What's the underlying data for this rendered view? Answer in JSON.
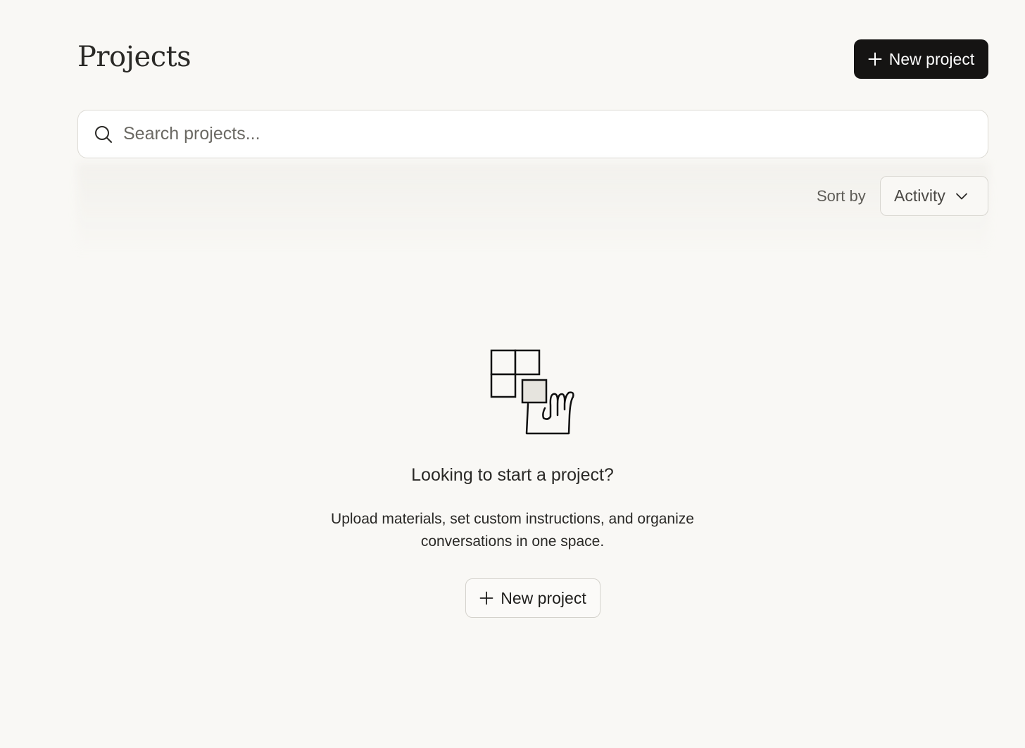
{
  "header": {
    "title": "Projects",
    "new_project_label": "New project"
  },
  "search": {
    "placeholder": "Search projects..."
  },
  "sort": {
    "label": "Sort by",
    "selected": "Activity"
  },
  "empty_state": {
    "title": "Looking to start a project?",
    "description": "Upload materials, set custom instructions, and organize conversations in one space.",
    "button_label": "New project"
  },
  "icons": {
    "primary_plus": "plus-icon",
    "search": "search-icon",
    "sort_chevron": "chevron-down-icon",
    "illustration": "grid-hand-illustration"
  },
  "colors": {
    "background": "#f9f8f5",
    "primary_button": "#151413",
    "text": "#2a2926",
    "muted_text": "#5e5c57",
    "border": "#dcdad4"
  }
}
